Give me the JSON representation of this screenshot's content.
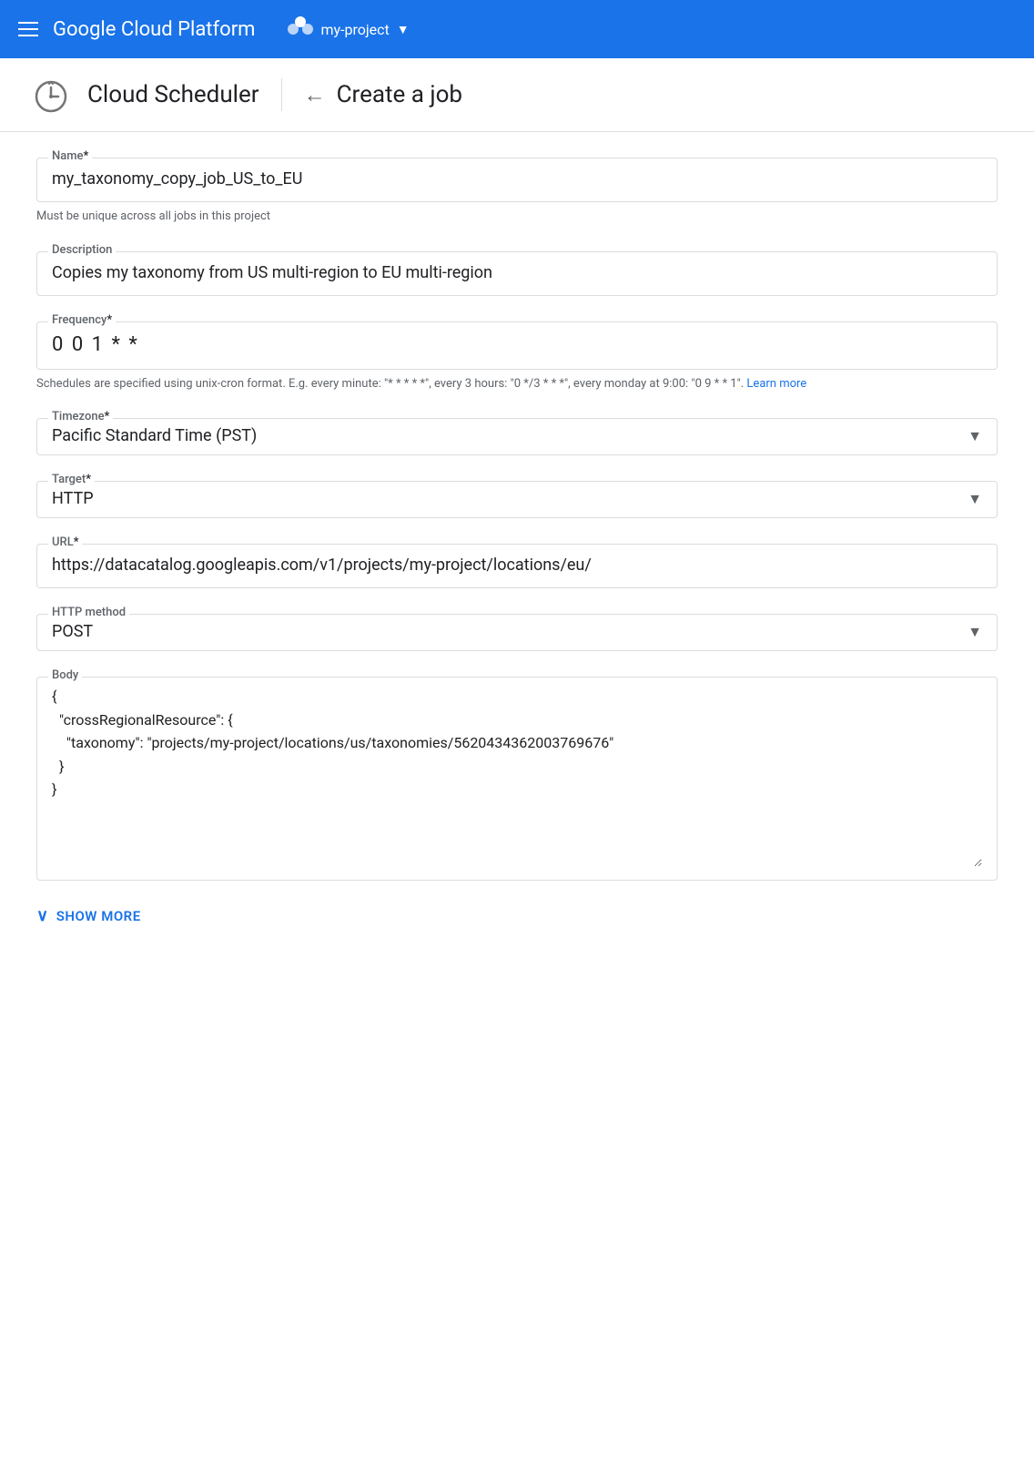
{
  "topbar": {
    "menu_label": "Menu",
    "title": "Google Cloud Platform",
    "project_name": "my-project",
    "chevron": "▼"
  },
  "subheader": {
    "app_name": "Cloud Scheduler",
    "back_arrow": "←",
    "page_title": "Create a job"
  },
  "form": {
    "name_field": {
      "label": "Name",
      "required": "*",
      "value": "my_taxonomy_copy_job_US_to_EU",
      "hint": "Must be unique across all jobs in this project"
    },
    "description_field": {
      "label": "Description",
      "value": "Copies my taxonomy from US multi-region to EU multi-region"
    },
    "frequency_field": {
      "label": "Frequency",
      "required": "*",
      "value": "0 0 1 * *",
      "hint": "Schedules are specified using unix-cron format. E.g. every minute: \"* * * * *\", every 3 hours: \"0 */3 * * *\", every monday at 9:00: \"0 9 * * 1\".",
      "hint_link": "Learn more",
      "hint_link_url": "#"
    },
    "timezone_field": {
      "label": "Timezone",
      "required": "*",
      "value": "Pacific Standard Time (PST)"
    },
    "target_field": {
      "label": "Target",
      "required": "*",
      "value": "HTTP"
    },
    "url_field": {
      "label": "URL",
      "required": "*",
      "value": "https://datacatalog.googleapis.com/v1/projects/my-project/locations/eu/"
    },
    "http_method_field": {
      "label": "HTTP method",
      "value": "POST"
    },
    "body_field": {
      "label": "Body",
      "value": "{\n  \"crossRegionalResource\": {\n    \"taxonomy\": \"projects/my-project/locations/us/taxonomies/5620434362003769676\"\n  }\n}"
    }
  },
  "show_more": {
    "label": "SHOW MORE",
    "chevron": "∨"
  }
}
